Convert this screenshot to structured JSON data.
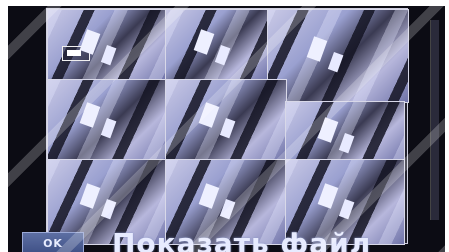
{
  "window": {
    "title": ""
  },
  "toolbar": {
    "ok_label": "OK"
  },
  "dialog": {
    "caption": "Показать файл"
  },
  "grid": {
    "columns": 3,
    "rows": 3,
    "cameras": 9
  },
  "colors": {
    "background": "#0c0c14",
    "button": "#4a5c92",
    "text": "#e7ebff"
  }
}
